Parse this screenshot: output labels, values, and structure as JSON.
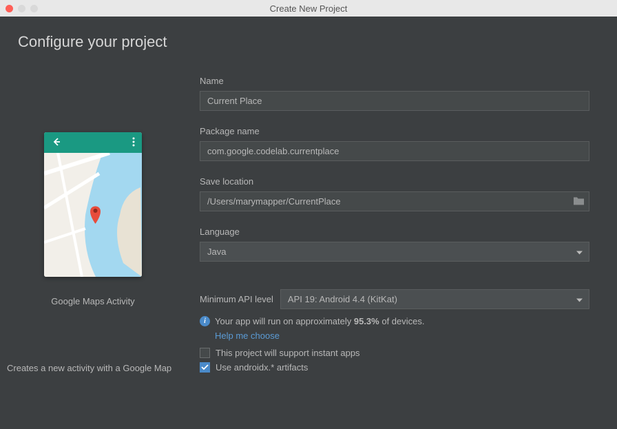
{
  "window": {
    "title": "Create New Project"
  },
  "page": {
    "title": "Configure your project"
  },
  "preview": {
    "label": "Google Maps Activity",
    "description": "Creates a new activity with a Google Map"
  },
  "fields": {
    "name": {
      "label": "Name",
      "value": "Current Place"
    },
    "package": {
      "label": "Package name",
      "value": "com.google.codelab.currentplace"
    },
    "save_location": {
      "label": "Save location",
      "value": "/Users/marymapper/CurrentPlace"
    },
    "language": {
      "label": "Language",
      "value": "Java"
    },
    "min_api": {
      "label": "Minimum API level",
      "value": "API 19: Android 4.4 (KitKat)"
    }
  },
  "info": {
    "text_prefix": "Your app will run on approximately ",
    "percent": "95.3%",
    "text_suffix": " of devices.",
    "help_link": "Help me choose"
  },
  "checkboxes": {
    "instant_apps": "This project will support instant apps",
    "androidx": "Use androidx.* artifacts"
  }
}
